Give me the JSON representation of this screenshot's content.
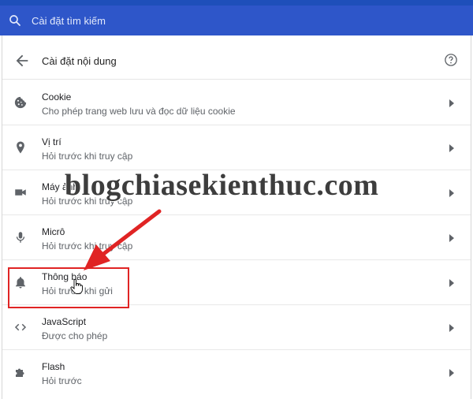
{
  "search": {
    "placeholder": "Cài đặt tìm kiếm",
    "icon": "search-icon"
  },
  "header": {
    "title": "Cài đặt nội dung",
    "back_icon": "arrow-back-icon",
    "help_icon": "help-icon"
  },
  "items": [
    {
      "title": "Cookie",
      "desc": "Cho phép trang web lưu và đọc dữ liệu cookie",
      "icon": "cookie-icon"
    },
    {
      "title": "Vị trí",
      "desc": "Hỏi trước khi truy cập",
      "icon": "location-pin-icon"
    },
    {
      "title": "Máy ảnh",
      "desc": "Hỏi trước khi truy cập",
      "icon": "camera-icon"
    },
    {
      "title": "Micrô",
      "desc": "Hỏi trước khi truy cập",
      "icon": "microphone-icon"
    },
    {
      "title": "Thông báo",
      "desc": "Hỏi trước khi gửi",
      "icon": "bell-icon"
    },
    {
      "title": "JavaScript",
      "desc": "Được cho phép",
      "icon": "code-icon"
    },
    {
      "title": "Flash",
      "desc": "Hỏi trước",
      "icon": "puzzle-icon"
    }
  ],
  "watermark": "blogchiasekienthuc.com",
  "colors": {
    "searchbar": "#2e56c9",
    "highlight": "#e02424",
    "arrow": "#e02424"
  }
}
